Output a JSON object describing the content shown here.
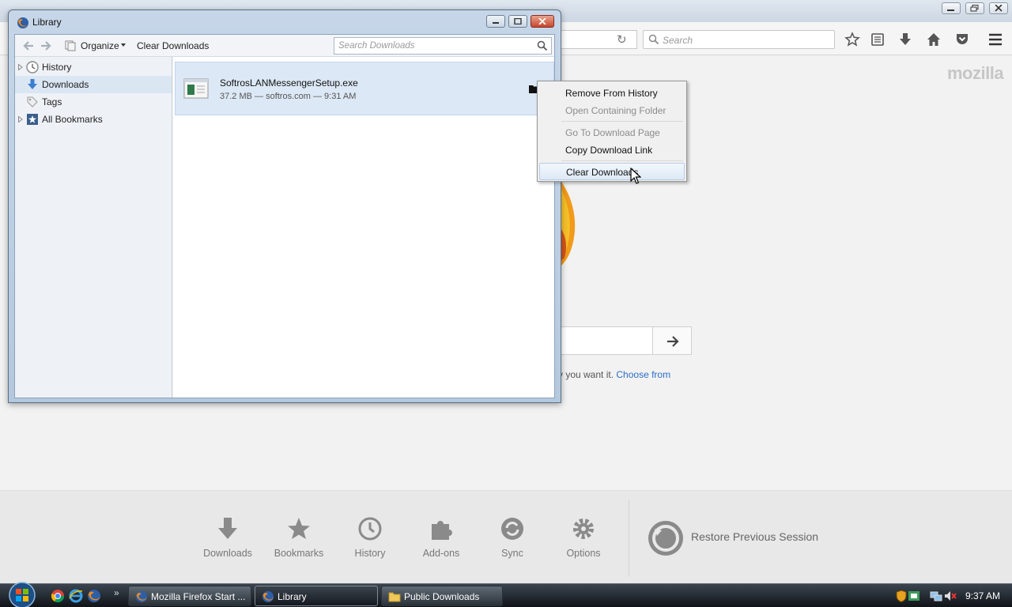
{
  "firefox": {
    "search_placeholder": "Search",
    "brand": "mozilla",
    "snippet_text": "y you want it.",
    "snippet_link": "Choose from",
    "launcher": {
      "downloads": "Downloads",
      "bookmarks": "Bookmarks",
      "history": "History",
      "addons": "Add-ons",
      "sync": "Sync",
      "options": "Options",
      "restore": "Restore Previous Session"
    }
  },
  "library": {
    "title": "Library",
    "toolbar": {
      "organize": "Organize",
      "clear_downloads": "Clear Downloads",
      "search_placeholder": "Search Downloads"
    },
    "sidebar": [
      {
        "label": "History",
        "icon": "clock-icon"
      },
      {
        "label": "Downloads",
        "icon": "download-arrow-icon"
      },
      {
        "label": "Tags",
        "icon": "tag-icon"
      },
      {
        "label": "All Bookmarks",
        "icon": "bookmarks-star-icon"
      }
    ],
    "download": {
      "filename": "SoftrosLANMessengerSetup.exe",
      "meta": "37.2 MB — softros.com — 9:31 AM"
    }
  },
  "context_menu": {
    "items": [
      {
        "label": "Remove From History",
        "enabled": true
      },
      {
        "label": "Open Containing Folder",
        "enabled": false
      },
      {
        "label": "Go To Download Page",
        "enabled": false
      },
      {
        "label": "Copy Download Link",
        "enabled": true
      },
      {
        "label": "Clear Downloads",
        "enabled": true
      }
    ]
  },
  "taskbar": {
    "tasks": [
      {
        "label": "Mozilla Firefox Start ..."
      },
      {
        "label": "Library"
      },
      {
        "label": "Public Downloads"
      }
    ],
    "quicklaunch_more": "»",
    "clock": "9:37 AM"
  },
  "colors": {
    "accent_link": "#2b6ec7",
    "selection": "#dce8f5",
    "close_button": "#c7472c"
  }
}
